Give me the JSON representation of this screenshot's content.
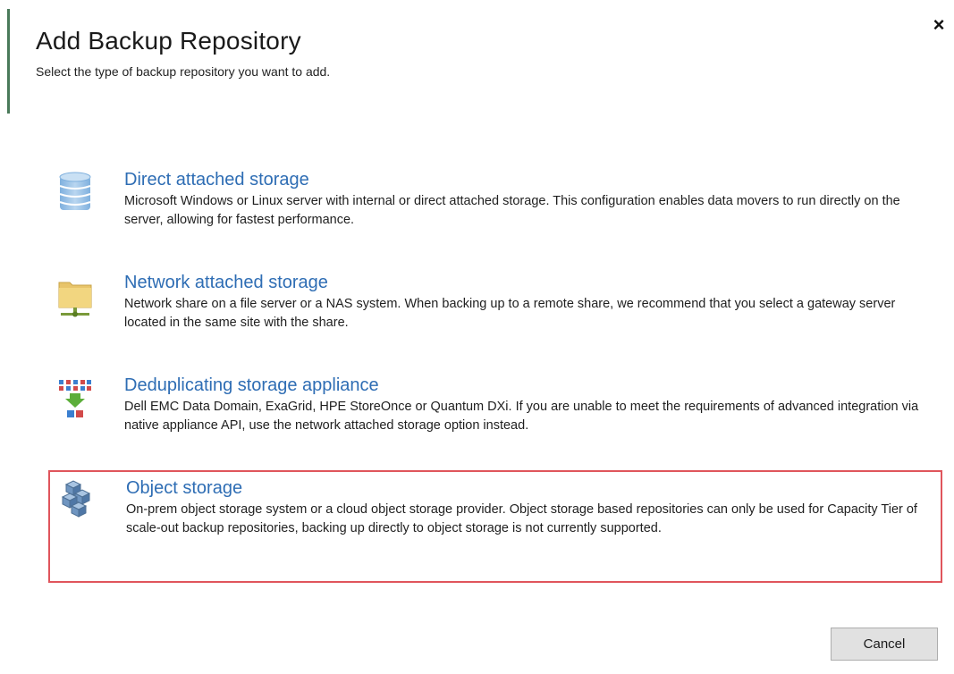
{
  "dialog": {
    "title": "Add Backup Repository",
    "subtitle": "Select the type of backup repository you want to add.",
    "close_glyph": "×"
  },
  "options": [
    {
      "title": "Direct attached storage",
      "description": "Microsoft Windows or Linux server with internal or direct attached storage. This configuration enables data movers to run directly on the server, allowing for fastest performance.",
      "icon": "database-icon"
    },
    {
      "title": "Network attached storage",
      "description": "Network share on a file server or a NAS system. When backing up to a remote share, we recommend that you select a gateway server located in the same site with the share.",
      "icon": "network-folder-icon"
    },
    {
      "title": "Deduplicating storage appliance",
      "description": "Dell EMC Data Domain, ExaGrid, HPE StoreOnce or Quantum DXi. If you are unable to meet the requirements of advanced integration via native appliance API, use the network attached storage option instead.",
      "icon": "deduplication-icon"
    },
    {
      "title": "Object storage",
      "description": "On-prem object storage system or a cloud object storage provider. Object storage based repositories can only be used for Capacity Tier of scale-out backup repositories, backing up directly to object storage is not currently supported.",
      "icon": "object-storage-icon",
      "highlighted": true
    }
  ],
  "buttons": {
    "cancel": "Cancel"
  },
  "colors": {
    "link_blue": "#2e6db4",
    "highlight_red": "#e0555c",
    "header_accent": "#4a7a5a"
  }
}
